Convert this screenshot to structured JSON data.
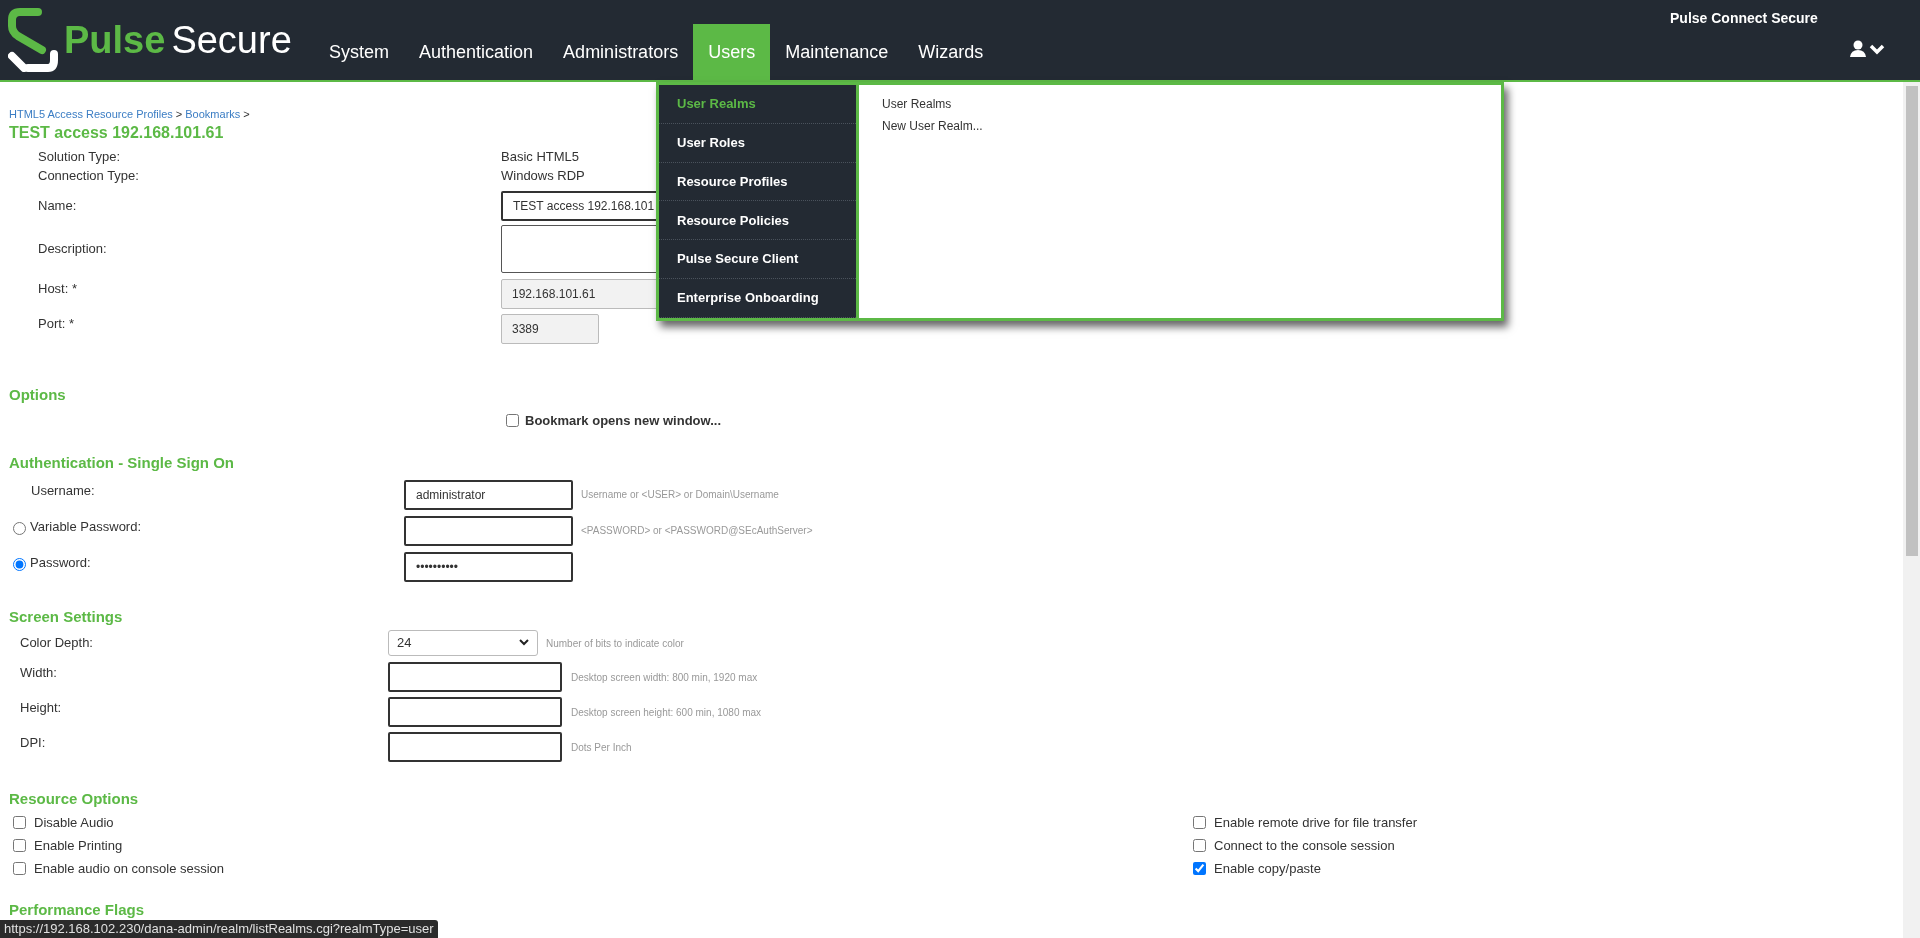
{
  "header": {
    "logo_primary": "Pulse",
    "logo_secondary": "Secure",
    "product": "Pulse Connect Secure",
    "nav": [
      {
        "label": "System",
        "selected": false
      },
      {
        "label": "Authentication",
        "selected": false
      },
      {
        "label": "Administrators",
        "selected": false
      },
      {
        "label": "Users",
        "selected": true
      },
      {
        "label": "Maintenance",
        "selected": false
      },
      {
        "label": "Wizards",
        "selected": false
      }
    ]
  },
  "menu": {
    "items": [
      {
        "label": "User Realms",
        "selected": true
      },
      {
        "label": "User Roles",
        "selected": false
      },
      {
        "label": "Resource Profiles",
        "selected": false
      },
      {
        "label": "Resource Policies",
        "selected": false
      },
      {
        "label": "Pulse Secure Client",
        "selected": false
      },
      {
        "label": "Enterprise Onboarding",
        "selected": false
      }
    ],
    "links": [
      "User Realms",
      "New User Realm..."
    ]
  },
  "breadcrumb": [
    {
      "label": "HTML5 Access Resource Profiles",
      "separator": ">"
    },
    {
      "label": "Bookmarks",
      "separator": ">"
    }
  ],
  "title": "TEST access 192.168.101.61",
  "details": [
    {
      "kind": "text",
      "label": "Solution Type:",
      "value": "Basic HTML5"
    },
    {
      "kind": "text",
      "label": "Connection Type:",
      "value": "Windows RDP"
    },
    {
      "kind": "input",
      "label": "Name:",
      "value": "TEST access 192.168.101"
    },
    {
      "kind": "textarea",
      "label": "Description:"
    },
    {
      "kind": "readonly",
      "label": "Host: *",
      "value": "192.168.101.61"
    },
    {
      "kind": "port",
      "label": "Port: *",
      "value": "3389"
    }
  ],
  "options": {
    "heading": "Options",
    "checkbox": {
      "label": "Bookmark opens new window...",
      "checked": false
    }
  },
  "auth": {
    "heading": "Authentication - Single Sign On",
    "rows": [
      {
        "kind": "plain",
        "label": "Username:",
        "value": "administrator",
        "hint": "Username or <USER> or Domain\\Username"
      },
      {
        "kind": "radio",
        "label": "Variable Password:",
        "selected": false,
        "hint": "<PASSWORD> or <PASSWORD@SEcAuthServer>"
      },
      {
        "kind": "radio",
        "label": "Password:",
        "selected": true,
        "value": "••••••••••"
      }
    ]
  },
  "screen": {
    "heading": "Screen Settings",
    "rows": [
      {
        "kind": "select",
        "label": "Color Depth:",
        "value": "24",
        "hint": "Number of bits to indicate color"
      },
      {
        "kind": "input",
        "label": "Width:",
        "hint": "Desktop screen width: 800 min, 1920 max"
      },
      {
        "kind": "input",
        "label": "Height:",
        "hint": "Desktop screen height: 600 min, 1080 max"
      },
      {
        "kind": "input",
        "label": "DPI:",
        "hint": "Dots Per Inch"
      }
    ]
  },
  "resource_options": {
    "heading": "Resource Options",
    "left": [
      {
        "label": "Disable Audio",
        "checked": false
      },
      {
        "label": "Enable Printing",
        "checked": false
      },
      {
        "label": "Enable audio on console session",
        "checked": false
      }
    ],
    "right": [
      {
        "label": "Enable remote drive for file transfer",
        "checked": false
      },
      {
        "label": "Connect to the console session",
        "checked": false
      },
      {
        "label": "Enable copy/paste",
        "checked": true
      }
    ]
  },
  "performance": {
    "heading": "Performance Flags"
  },
  "status_url": "https://192.168.102.230/dana-admin/realm/listRealms.cgi?realmType=user"
}
